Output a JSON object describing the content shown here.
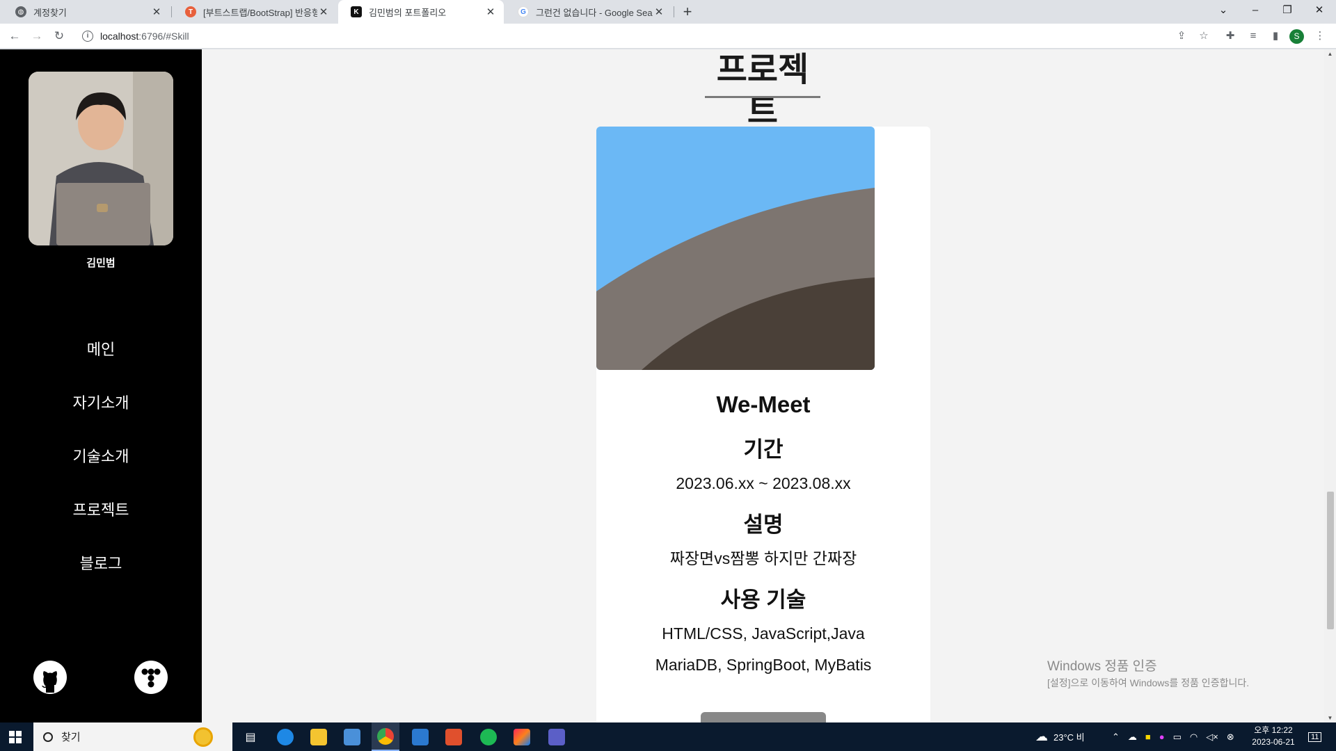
{
  "browser": {
    "tabs": [
      {
        "title": "계정찾기"
      },
      {
        "title": "[부트스트랩/BootStrap] 반응형"
      },
      {
        "title": "김민범의 포트폴리오"
      },
      {
        "title": "그런건 없습니다 - Google Search"
      }
    ],
    "url_host": "localhost",
    "url_path": ":6796/#Skill",
    "profile_initial": "S"
  },
  "sidebar": {
    "name": "김민범",
    "nav": [
      "메인",
      "자기소개",
      "기술소개",
      "프로젝트",
      "블로그"
    ]
  },
  "main": {
    "section_title": "프로젝트",
    "project": {
      "title": "We-Meet",
      "period_heading": "기간",
      "period": "2023.06.xx ~ 2023.08.xx",
      "desc_heading": "설명",
      "desc": "짜장면vs짬뽕 하지만 간짜장",
      "tech_heading": "사용 기술",
      "tech_line1": "HTML/CSS, JavaScript,Java",
      "tech_line2": "MariaDB, SpringBoot, MyBatis"
    }
  },
  "watermark": {
    "line1": "Windows 정품 인증",
    "line2": "[설정]으로 이동하여 Windows를 정품 인증합니다."
  },
  "taskbar": {
    "search_placeholder": "찾기",
    "weather": "23°C 비",
    "time": "오후 12:22",
    "date": "2023-06-21",
    "notification_count": "11"
  },
  "colors": {
    "sidebar_bg": "#000000",
    "page_bg": "#f3f3f3",
    "card_bg": "#ffffff",
    "sky": "#6bb8f5",
    "hill_light": "#7d7570",
    "hill_dark": "#4a4038"
  }
}
